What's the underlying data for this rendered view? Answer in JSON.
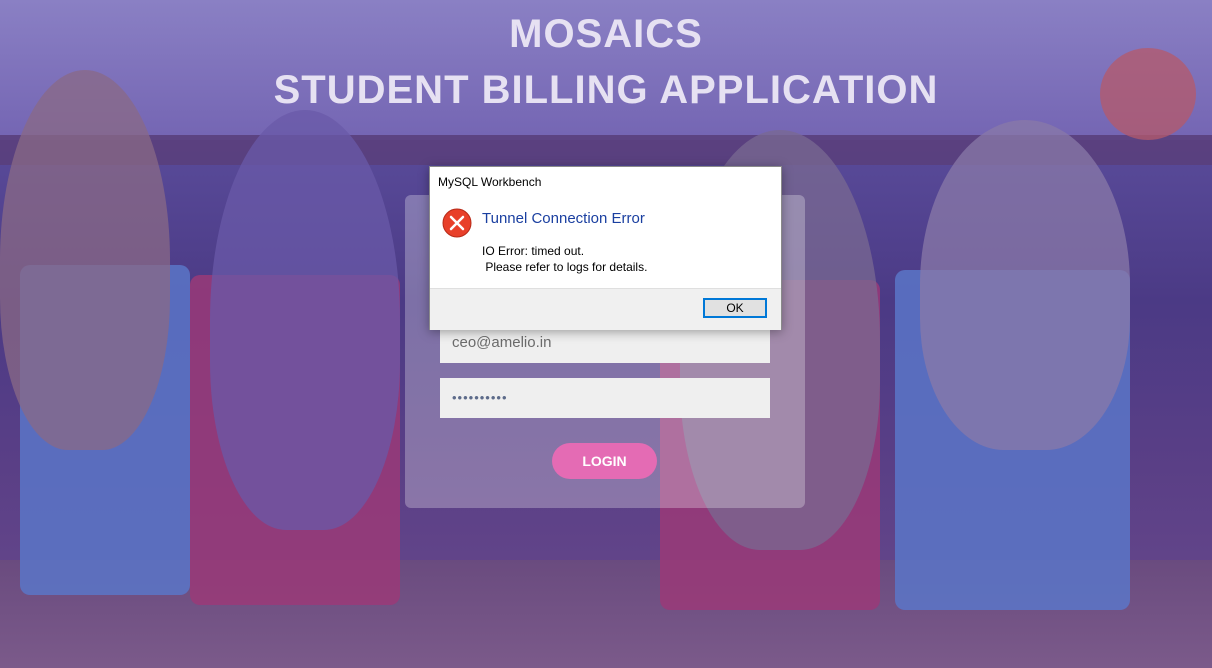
{
  "app": {
    "title_line1": "MOSAICS",
    "title_line2": "STUDENT BILLING APPLICATION"
  },
  "login_form": {
    "email_value": "ceo@amelio.in",
    "password_mask": "••••••••••",
    "login_label": "LOGIN"
  },
  "dialog": {
    "window_title": "MySQL Workbench",
    "heading": "Tunnel Connection Error",
    "message_line1": "IO Error: timed out.",
    "message_line2": " Please refer to logs for details.",
    "ok_label": "OK",
    "icon": "error-x-icon"
  },
  "colors": {
    "overlay": "#5a4c9b",
    "login_button": "#e46bb4",
    "dialog_heading": "#1a3fa0",
    "error_icon": "#e8402a",
    "ok_border": "#0078d7"
  }
}
